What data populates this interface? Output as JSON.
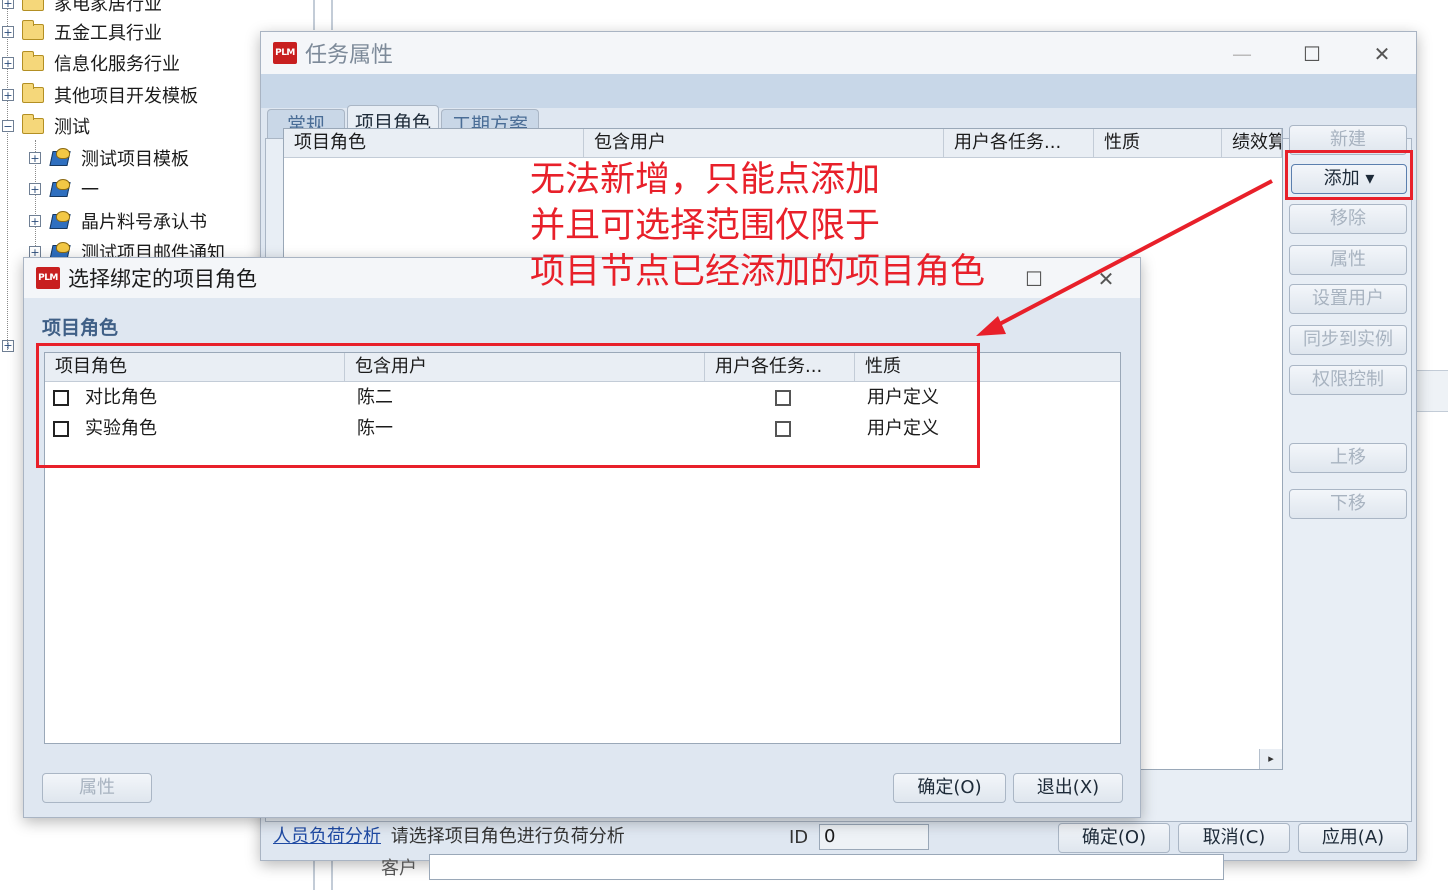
{
  "tree": {
    "items": [
      {
        "label": "家电家居行业",
        "expander": "+"
      },
      {
        "label": "五金工具行业",
        "expander": "+"
      },
      {
        "label": "信息化服务行业",
        "expander": "+"
      },
      {
        "label": "其他项目开发模板",
        "expander": "+"
      },
      {
        "label": "测试",
        "expander": "−"
      },
      {
        "label": "测试项目模板",
        "expander": "+"
      },
      {
        "label": "一",
        "expander": "+"
      },
      {
        "label": "晶片料号承认书",
        "expander": "+"
      },
      {
        "label": "测试项目邮件通知",
        "expander": "+"
      }
    ]
  },
  "task_window": {
    "logo": "PLM",
    "title": "任务属性",
    "tabs": [
      {
        "label": "常规",
        "active": false
      },
      {
        "label": "项目角色",
        "active": true
      },
      {
        "label": "工期方案",
        "active": false
      }
    ],
    "grid_columns": [
      "项目角色",
      "包含用户",
      "用户各任务...",
      "性质",
      "绩效算"
    ],
    "side_buttons": {
      "new": "新建",
      "add": "添加 ▾",
      "remove": "移除",
      "properties": "属性",
      "set_user": "设置用户",
      "sync": "同步到实例",
      "permission": "权限控制",
      "move_up": "上移",
      "move_down": "下移"
    },
    "footer": {
      "load_link": "人员负荷分析",
      "load_hint": "请选择项目角色进行负荷分析",
      "id_label": "ID",
      "id_value": "0",
      "customer_label": "客户",
      "ok": "确定(O)",
      "cancel": "取消(C)",
      "apply": "应用(A)"
    }
  },
  "select_dialog": {
    "logo": "PLM",
    "title": "选择绑定的项目角色",
    "section_label": "项目角色",
    "columns": [
      "项目角色",
      "包含用户",
      "用户各任务...",
      "性质"
    ],
    "rows": [
      {
        "role": "对比角色",
        "users": "陈二",
        "nature": "用户定义"
      },
      {
        "role": "实验角色",
        "users": "陈一",
        "nature": "用户定义"
      }
    ],
    "buttons": {
      "properties": "属性",
      "ok": "确定(O)",
      "exit": "退出(X)"
    }
  },
  "annotation": {
    "lines": [
      "无法新增，只能点添加",
      "并且可选择范围仅限于",
      "项目节点已经添加的项目角色"
    ],
    "color": "#e8202a"
  }
}
